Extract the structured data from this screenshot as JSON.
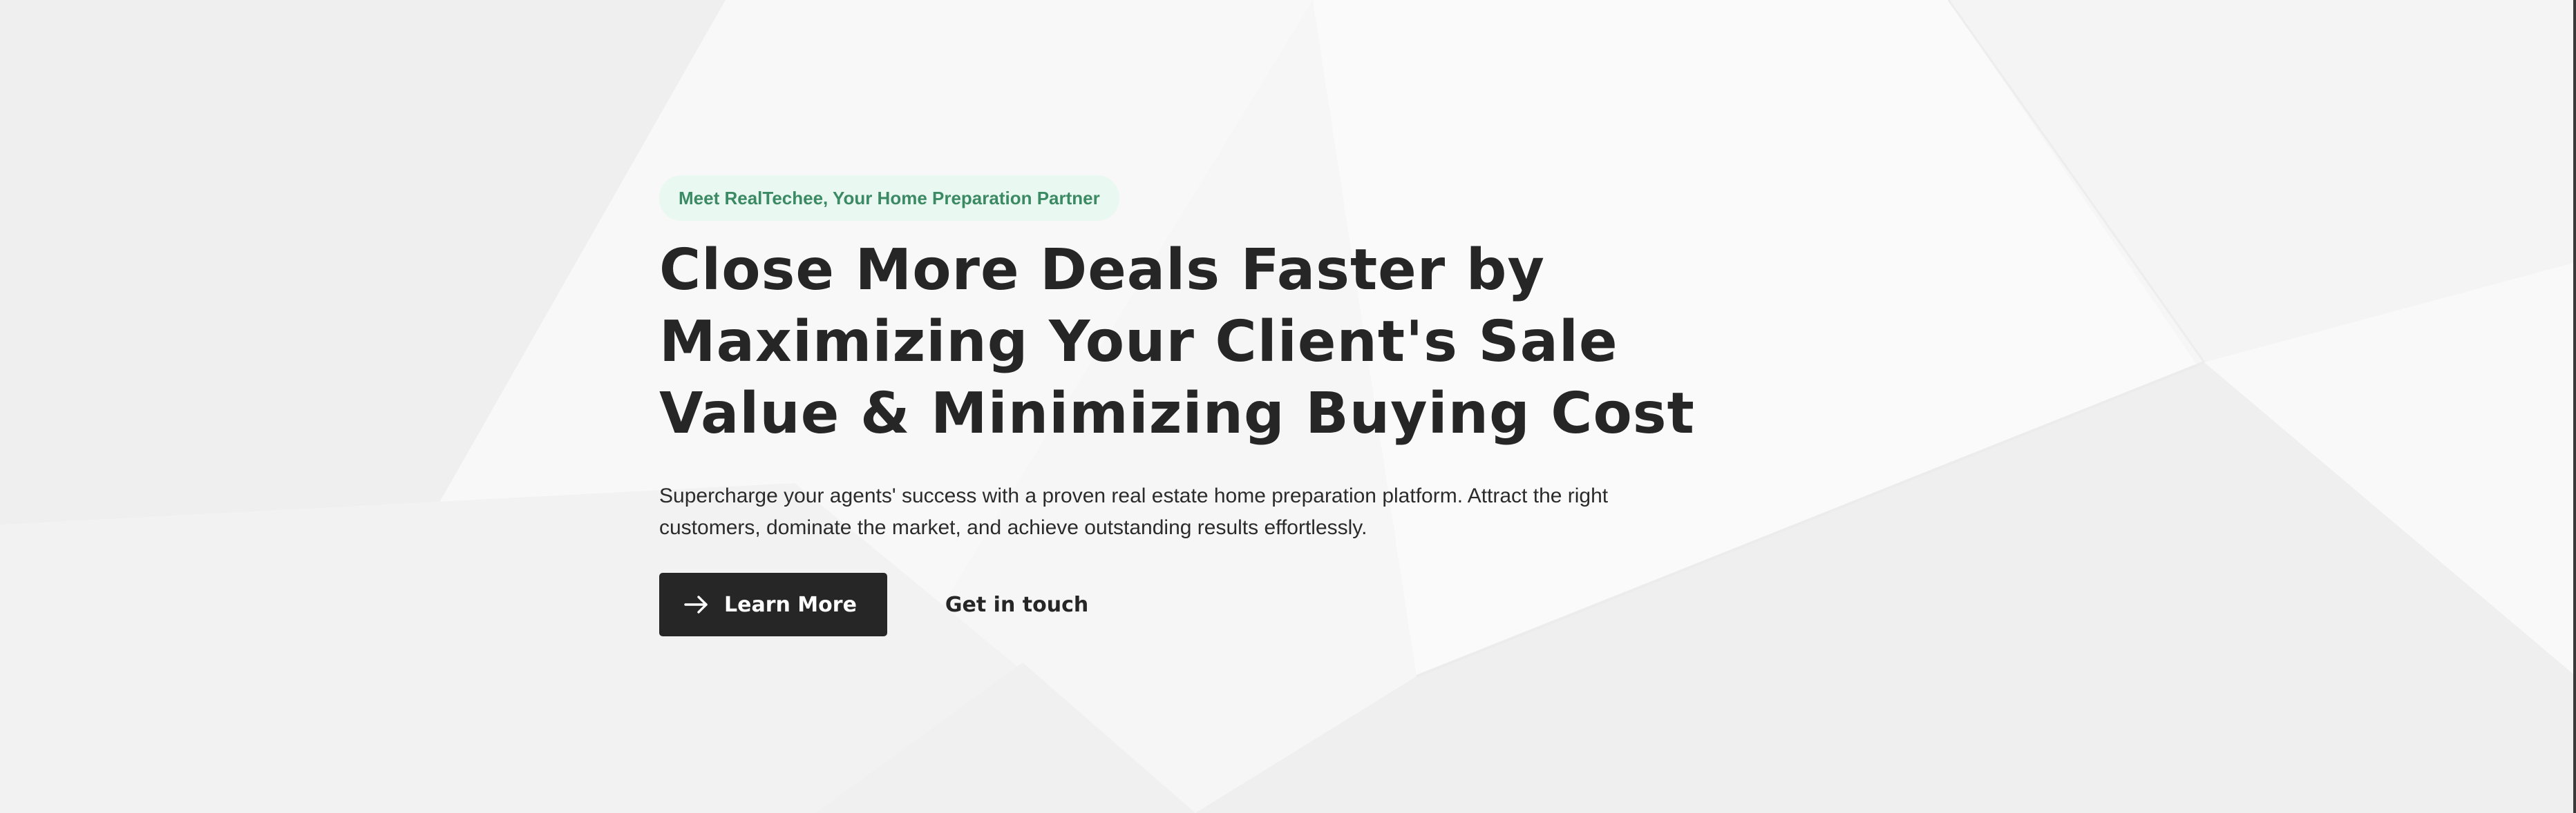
{
  "hero": {
    "badge": "Meet RealTechee, Your Home Preparation Partner",
    "headline_lines": [
      "Close More Deals Faster by",
      "Maximizing Your Client's Sale",
      "Value & Minimizing Buying Cost"
    ],
    "subtext_lines": [
      "Supercharge your agents' success with a proven real estate home preparation platform. Attract the right",
      "customers, dominate the market, and achieve outstanding results effortlessly."
    ],
    "primary_button": {
      "label": "Learn More",
      "icon": "arrow-right-icon"
    },
    "secondary_button": {
      "label": "Get in touch"
    }
  },
  "colors": {
    "background": "#f7f7f7",
    "badge_background": "#e9f8f1",
    "badge_text": "#3b8a64",
    "heading": "#262626",
    "primary_button": "#262626",
    "primary_button_text": "#ffffff"
  }
}
